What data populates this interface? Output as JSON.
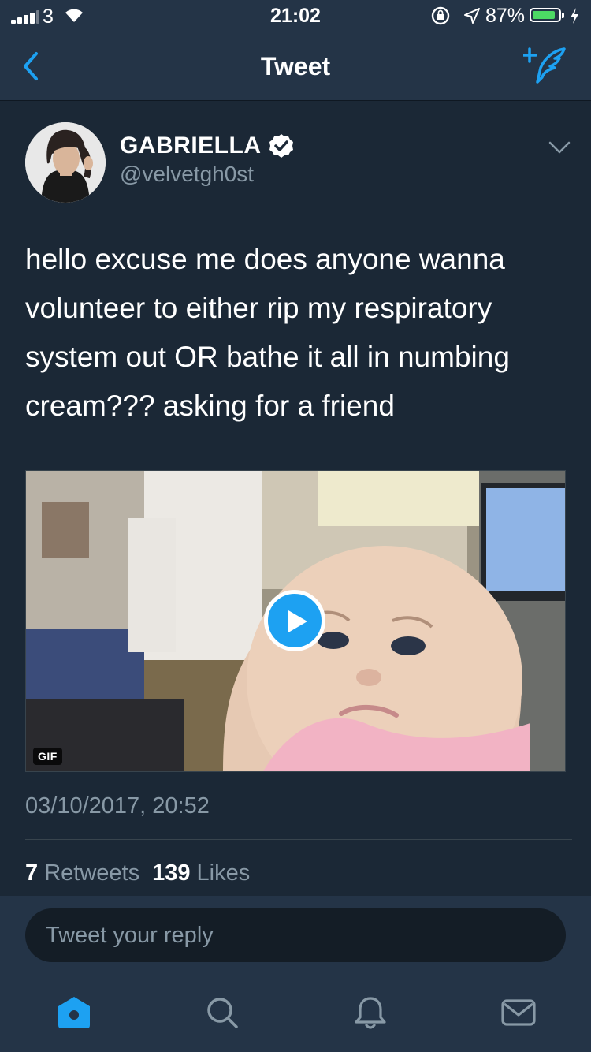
{
  "status_bar": {
    "carrier": "3",
    "time": "21:02",
    "battery_percent": "87%",
    "battery_level": 0.87,
    "icons": [
      "signal-icon",
      "wifi-icon",
      "orientation-lock-icon",
      "location-arrow-icon",
      "battery-icon",
      "charging-bolt-icon"
    ]
  },
  "nav": {
    "title": "Tweet",
    "back_icon": "chevron-left-icon",
    "compose_icon": "compose-tweet-icon"
  },
  "tweet": {
    "display_name": "GABRIELLA",
    "verified": true,
    "handle": "@velvetgh0st",
    "text": "hello excuse me does anyone wanna volunteer to either rip my respiratory system out OR bathe it all in numbing cream??? asking for a friend",
    "media": {
      "type": "gif",
      "badge": "GIF",
      "play_icon": "play-icon"
    },
    "timestamp": "03/10/2017, 20:52",
    "retweets_count": "7",
    "retweets_label": "Retweets",
    "likes_count": "139",
    "likes_label": "Likes"
  },
  "reply": {
    "placeholder": "Tweet your reply"
  },
  "tabs": [
    {
      "name": "home",
      "icon": "home-icon",
      "active": true
    },
    {
      "name": "search",
      "icon": "search-icon",
      "active": false
    },
    {
      "name": "notifications",
      "icon": "bell-icon",
      "active": false
    },
    {
      "name": "messages",
      "icon": "envelope-icon",
      "active": false
    }
  ],
  "colors": {
    "background": "#1b2836",
    "bar": "#243447",
    "accent": "#1da1f2",
    "secondary_text": "#8899a6",
    "battery": "#4cd964"
  }
}
